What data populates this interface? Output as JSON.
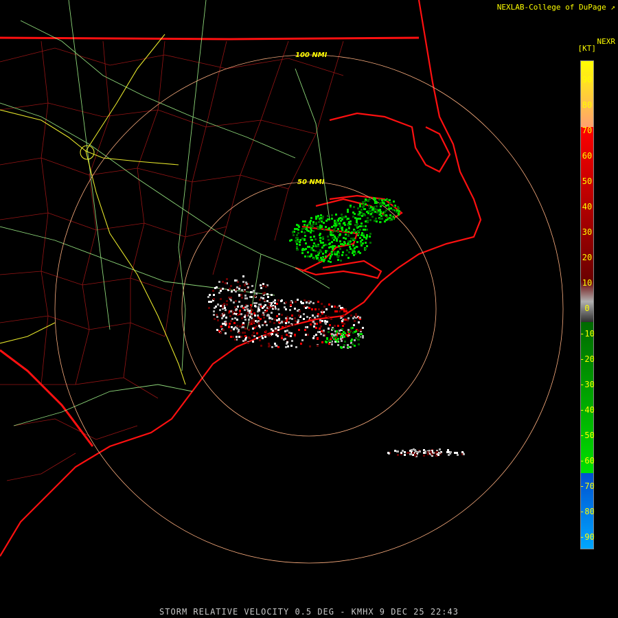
{
  "credit": "NEXLAB-College of DuPage",
  "product_name": "NEXR",
  "unit_label": "[KT]",
  "footer": "STORM RELATIVE VELOCITY 0.5 DEG - KMHX 9 DEC 25 22:43",
  "range_rings": [
    {
      "label": "100 NMI"
    },
    {
      "label": "50 NMI"
    }
  ],
  "scale": {
    "ticks": [
      "90",
      "80",
      "70",
      "60",
      "50",
      "40",
      "30",
      "20",
      "10",
      "0",
      "-10",
      "-20",
      "-30",
      "-40",
      "-50",
      "-60",
      "-70",
      "-80",
      "-90"
    ],
    "colors": {
      "yellow": "#ffff00",
      "orange": "#ffa070",
      "red": "#ff0000",
      "dark_red": "#6a0000",
      "gray": "#b0b0b0",
      "dark_green": "#006a00",
      "green": "#00e000",
      "blue": "#0050d0",
      "light_blue": "#00a8ff"
    }
  },
  "map_colors": {
    "coast": "#ff1010",
    "county": "#b01818",
    "highway": "#b0ff9a",
    "interstate": "#ffff30",
    "ring": "#ffb080"
  }
}
